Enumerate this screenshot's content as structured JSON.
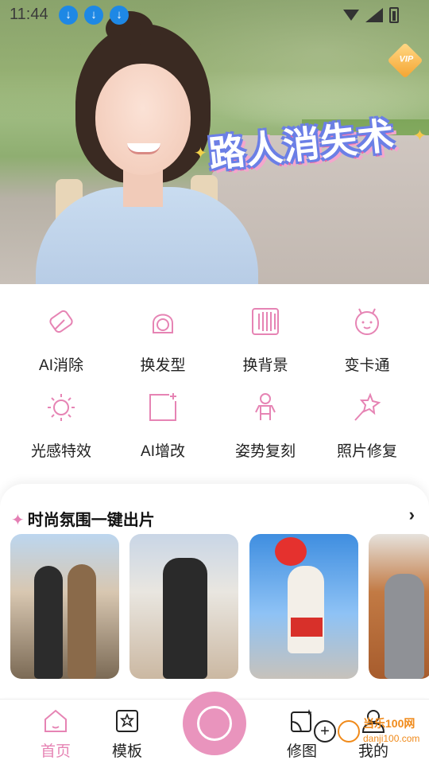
{
  "status_bar": {
    "time": "11:44",
    "download_icons": [
      "download-icon",
      "download-icon",
      "download-icon"
    ]
  },
  "banner": {
    "title": "路人消失术",
    "badge": "VIP"
  },
  "tools": [
    {
      "label": "AI消除",
      "icon": "eraser-icon"
    },
    {
      "label": "换发型",
      "icon": "hairstyle-icon"
    },
    {
      "label": "换背景",
      "icon": "background-icon"
    },
    {
      "label": "变卡通",
      "icon": "cartoon-icon"
    },
    {
      "label": "光感特效",
      "icon": "light-effect-icon"
    },
    {
      "label": "AI增改",
      "icon": "ai-edit-icon"
    },
    {
      "label": "姿势复刻",
      "icon": "pose-icon"
    },
    {
      "label": "照片修复",
      "icon": "magic-wand-icon"
    }
  ],
  "section": {
    "title": "时尚氛围一键出片",
    "more_icon": "chevron-right-icon"
  },
  "nav": {
    "home": "首页",
    "templates": "模板",
    "edit": "修图",
    "mine": "我的"
  },
  "watermark": {
    "line1": "当乐100网",
    "line2": "danji100.com"
  },
  "colors": {
    "accent_pink": "#e994bd",
    "icon_pink": "#e684b4"
  }
}
